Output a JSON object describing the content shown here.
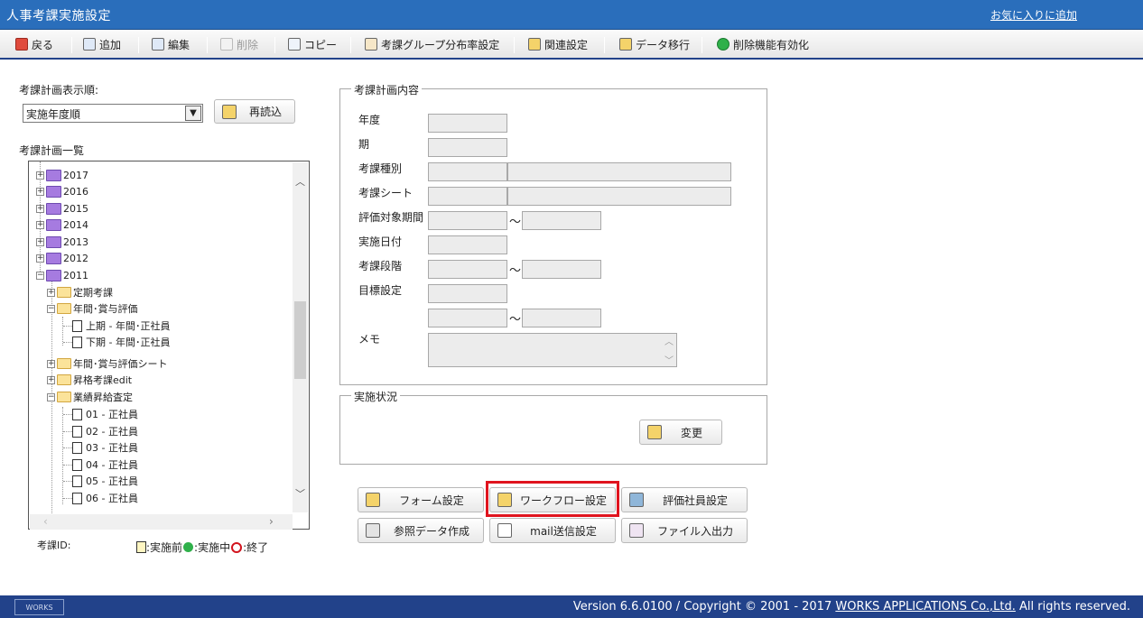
{
  "window": {
    "title": "人事考課実施設定",
    "favorite_link": "お気に入りに追加"
  },
  "toolbar": {
    "back": "戻る",
    "add": "追加",
    "edit": "編集",
    "delete": "削除",
    "copy": "コピー",
    "group_dist": "考課グループ分布率設定",
    "related": "関連設定",
    "migrate": "データ移行",
    "enable_delete": "削除機能有効化"
  },
  "left": {
    "order_label": "考課計画表示順:",
    "order_value": "実施年度順",
    "reload": "再読込",
    "list_label": "考課計画一覧",
    "id_label": "考課ID:",
    "legend_before": ":実施前",
    "legend_during": ":実施中",
    "legend_end": ":終了"
  },
  "tree": {
    "y2017": "2017",
    "y2016": "2016",
    "y2015": "2015",
    "y2014": "2014",
    "y2013": "2013",
    "y2012": "2012",
    "y2011": "2011",
    "teiki": "定期考課",
    "nenkan": "年間･賞与評価",
    "kamiki": "上期 - 年間･正社員",
    "shimoki": "下期 - 年間･正社員",
    "nenkan_sheet": "年間･賞与評価シート",
    "shokaku": "昇格考課edit",
    "gyoseki": "業績昇給査定",
    "s01": "01 - 正社員",
    "s02": "02 - 正社員",
    "s03": "03 - 正社員",
    "s04": "04 - 正社員",
    "s05": "05 - 正社員",
    "s06": "06 - 正社員"
  },
  "plan": {
    "legend": "考課計画内容",
    "year": "年度",
    "term": "期",
    "type": "考課種別",
    "sheet": "考課シート",
    "period": "評価対象期間",
    "date": "実施日付",
    "stage": "考課段階",
    "goal": "目標設定",
    "memo": "メモ",
    "tilde": "～"
  },
  "status": {
    "legend": "実施状況",
    "change": "変更"
  },
  "actions": {
    "form": "フォーム設定",
    "workflow": "ワークフロー設定",
    "employee": "評価社員設定",
    "reference": "参照データ作成",
    "mail": "mail送信設定",
    "file": "ファイル入出力"
  },
  "footer": {
    "logo": "WORKS",
    "version": "Version 6.6.0100 / Copyright © 2001 - 2017 ",
    "company": "WORKS APPLICATIONS Co.,Ltd.",
    "rights": " All rights reserved."
  },
  "colors": {
    "titlebar": "#2a6ebb",
    "footer": "#22428a",
    "highlight": "#e0141e"
  }
}
